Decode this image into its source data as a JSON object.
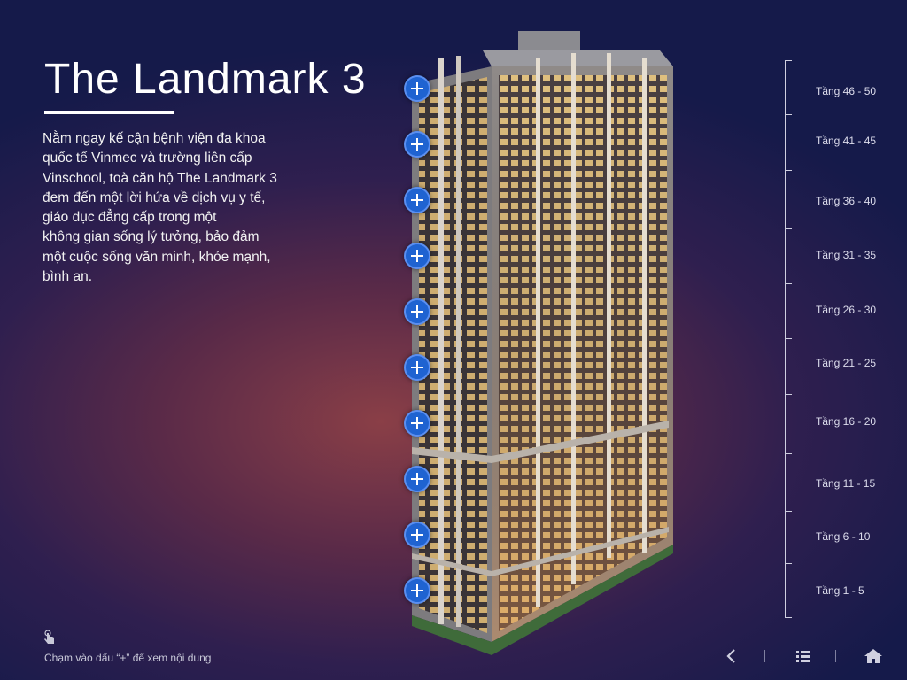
{
  "title": "The Landmark 3",
  "description": [
    "Nằm ngay kế cận bệnh viện đa khoa",
    "quốc tế Vinmec và trường liên cấp",
    "Vinschool, toà căn hộ The Landmark 3",
    "đem đến một lời hứa về dịch vụ y tế,",
    "giáo dục đẳng cấp trong một",
    "không gian sống lý tưởng, bảo đảm",
    "một cuộc sống văn minh, khỏe mạnh,",
    "bình an."
  ],
  "floors": [
    "Tầng 46 - 50",
    "Tầng 41 - 45",
    "Tầng 36 - 40",
    "Tầng 31 - 35",
    "Tầng 26 - 30",
    "Tầng 21 - 25",
    "Tầng 16 - 20",
    "Tầng 11 - 15",
    "Tầng 6 - 10",
    "Tầng 1 - 5"
  ],
  "hint": "Chạm vào dấu “+” để xem nội dung",
  "nav": {
    "back_icon": "chevron-left-icon",
    "list_icon": "list-icon",
    "home_icon": "home-icon"
  },
  "colors": {
    "accent": "#1f63d1",
    "background_top": "#151a4a",
    "background_glow": "#8a3f47"
  }
}
